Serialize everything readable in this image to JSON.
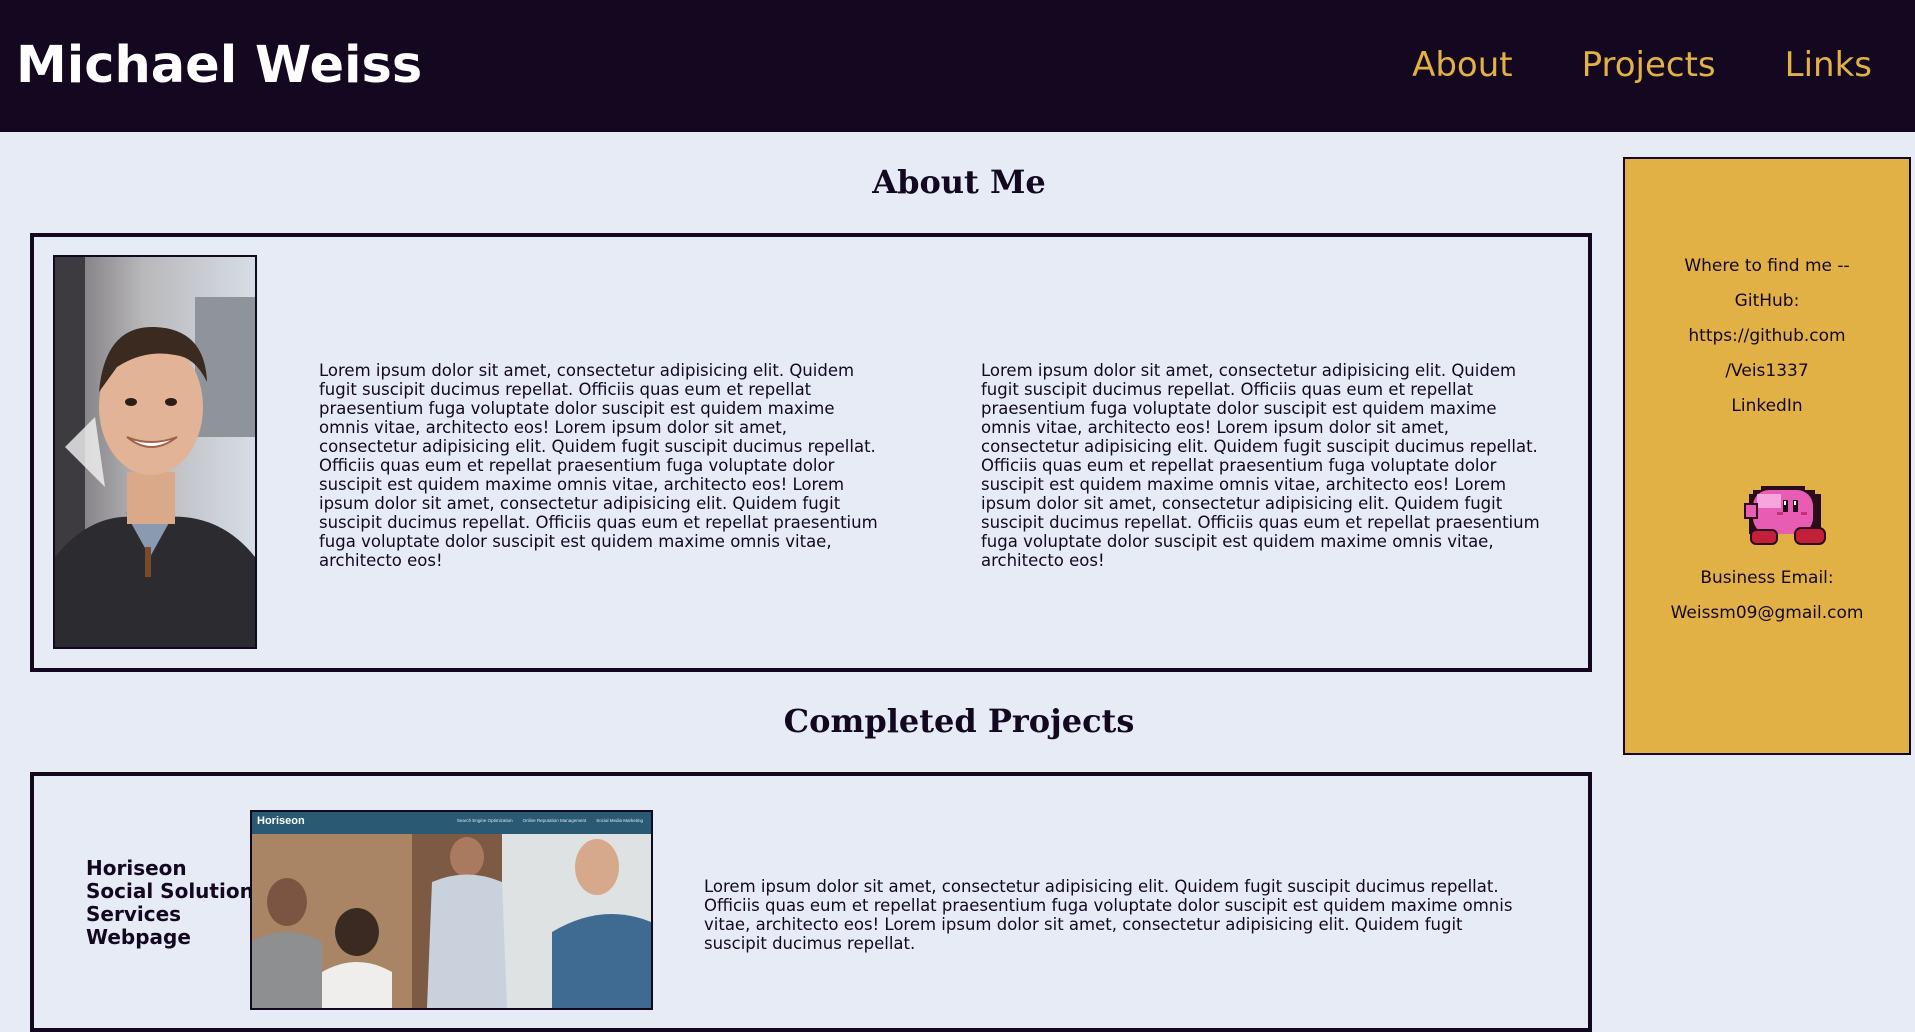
{
  "header": {
    "title": "Michael Weiss",
    "nav": [
      "About",
      "Projects",
      "Links"
    ]
  },
  "about": {
    "heading": "About Me",
    "paragraphs": [
      "Lorem ipsum dolor sit amet, consectetur adipisicing elit. Quidem fugit suscipit ducimus repellat. Officiis quas eum et repellat praesentium fuga voluptate dolor suscipit est quidem maxime omnis vitae, architecto eos! Lorem ipsum dolor sit amet, consectetur adipisicing elit. Quidem fugit suscipit ducimus repellat. Officiis quas eum et repellat praesentium fuga voluptate dolor suscipit est quidem maxime omnis vitae, architecto eos! Lorem ipsum dolor sit amet, consectetur adipisicing elit. Quidem fugit suscipit ducimus repellat. Officiis quas eum et repellat praesentium fuga voluptate dolor suscipit est quidem maxime omnis vitae, architecto eos!",
      "Lorem ipsum dolor sit amet, consectetur adipisicing elit. Quidem fugit suscipit ducimus repellat. Officiis quas eum et repellat praesentium fuga voluptate dolor suscipit est quidem maxime omnis vitae, architecto eos! Lorem ipsum dolor sit amet, consectetur adipisicing elit. Quidem fugit suscipit ducimus repellat. Officiis quas eum et repellat praesentium fuga voluptate dolor suscipit est quidem maxime omnis vitae, architecto eos! Lorem ipsum dolor sit amet, consectetur adipisicing elit. Quidem fugit suscipit ducimus repellat. Officiis quas eum et repellat praesentium fuga voluptate dolor suscipit est quidem maxime omnis vitae, architecto eos!"
    ]
  },
  "projects": {
    "heading": "Completed Projects",
    "items": [
      {
        "title": "Horiseon Social Solution Services Webpage",
        "screenshot_brand": "Horiseon",
        "screenshot_nav": [
          "Search Engine Optimization",
          "Online Reputation Management",
          "Social Media Marketing"
        ],
        "description": "Lorem ipsum dolor sit amet, consectetur adipisicing elit. Quidem fugit suscipit ducimus repellat. Officiis quas eum et repellat praesentium fuga voluptate dolor suscipit est quidem maxime omnis vitae, architecto eos! Lorem ipsum dolor sit amet, consectetur adipisicing elit. Quidem fugit suscipit ducimus repellat."
      }
    ]
  },
  "sidebar": {
    "intro": "Where to find me --",
    "github_label": "GitHub:",
    "github_url_line1": "https://github.com",
    "github_url_line2": "/Veis1337",
    "linkedin_label": "LinkedIn",
    "email_label": "Business Email:",
    "email": "Weissm09@gmail.com",
    "mascot_icon": "kirby-sprite-icon"
  },
  "colors": {
    "header_bg": "#130820",
    "page_bg": "#e6ebf5",
    "accent": "#e2b146",
    "text": "#130820"
  }
}
